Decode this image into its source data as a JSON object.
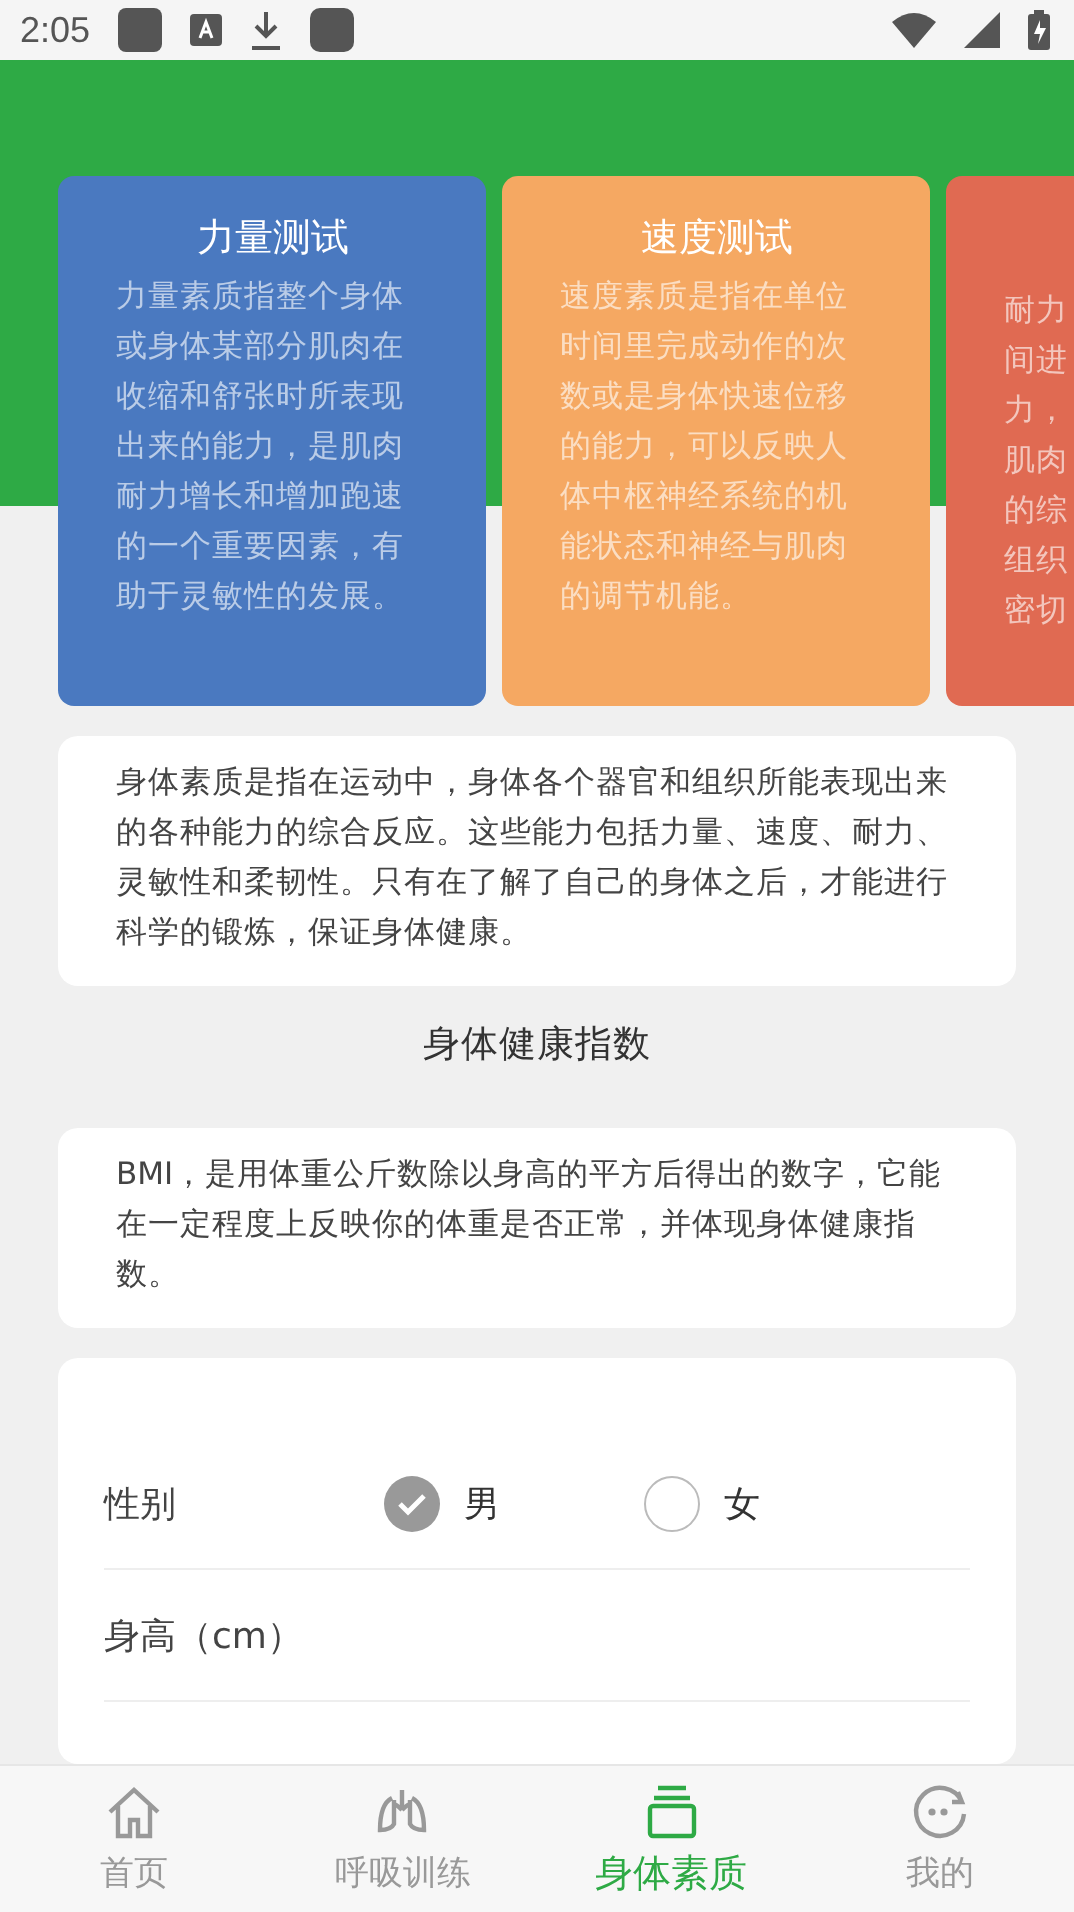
{
  "status_bar": {
    "time": "2:05"
  },
  "cards": [
    {
      "title": "力量测试",
      "color": "#4a79c0",
      "lines": [
        "力量素质指整个身体",
        "或身体某部分肌肉在",
        "收缩和舒张时所表现",
        "出来的能力，是肌肉",
        "耐力增长和增加跑速",
        "的一个重要因素，有",
        "助于灵敏性的发展。"
      ]
    },
    {
      "title": "速度测试",
      "color": "#f5a862",
      "lines": [
        "速度素质是指在单位",
        "时间里完成动作的次",
        "数或是身体快速位移",
        "的能力，可以反映人",
        "体中枢神经系统的机",
        "能状态和神经与肌肉",
        "的调节机能。"
      ]
    },
    {
      "color": "#e06a52",
      "lines": [
        "耐力",
        "间进",
        "力，",
        "肌肉",
        "的综",
        "组织",
        "密切"
      ]
    }
  ],
  "intro": "身体素质是指在运动中，身体各个器官和组织所能表现出来的各种能力的综合反应。这些能力包括力量、速度、耐力、灵敏性和柔韧性。只有在了解了自己的身体之后，才能进行科学的锻炼，保证身体健康。",
  "section_title": "身体健康指数",
  "bmi_text": "BMI，是用体重公斤数除以身高的平方后得出的数字，它能在一定程度上反映你的体重是否正常，并体现身体健康指数。",
  "form": {
    "gender_label": "性别",
    "genders": [
      {
        "label": "男",
        "selected": true
      },
      {
        "label": "女",
        "selected": false
      }
    ],
    "height_label": "身高（cm）"
  },
  "nav": [
    {
      "label": "首页",
      "kind": "home",
      "selected": false
    },
    {
      "label": "呼吸训练",
      "kind": "lungs",
      "selected": false
    },
    {
      "label": "身体素质",
      "kind": "body",
      "selected": true
    },
    {
      "label": "我的",
      "kind": "face",
      "selected": false
    }
  ]
}
